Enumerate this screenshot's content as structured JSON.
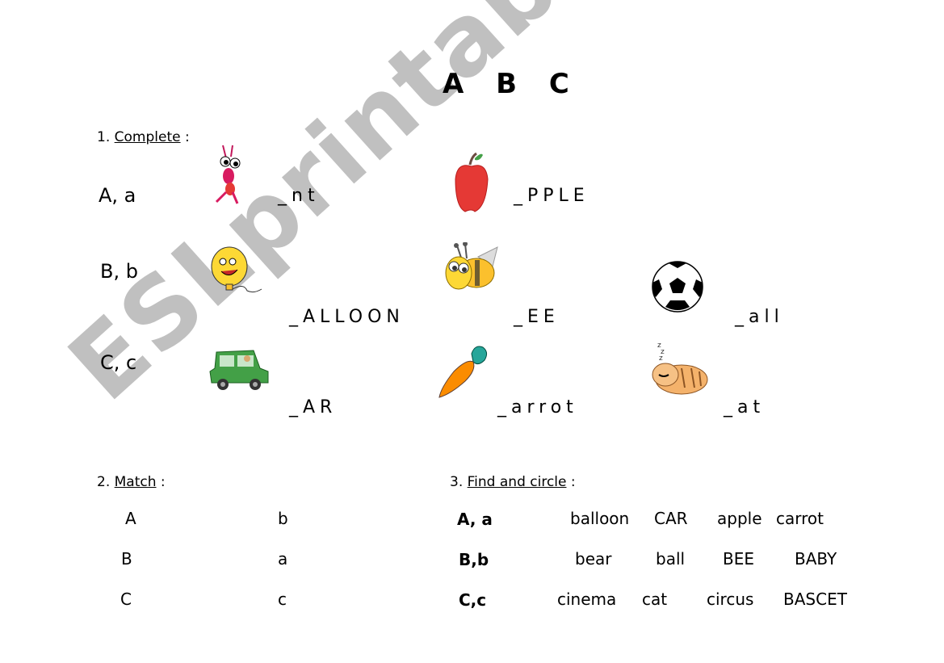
{
  "title": "A B C",
  "section1": {
    "number": "1.",
    "label": "Complete",
    "colon": ":",
    "rows": [
      {
        "letter": "A, a",
        "items": [
          {
            "picture": "ant-icon",
            "blank": "_nt"
          },
          {
            "picture": "apple-icon",
            "blank": "_PPLE"
          }
        ]
      },
      {
        "letter": "B, b",
        "items": [
          {
            "picture": "balloon-icon",
            "blank": "_ALLOON"
          },
          {
            "picture": "bee-icon",
            "blank": "_EE"
          },
          {
            "picture": "ball-icon",
            "blank": "_all"
          }
        ]
      },
      {
        "letter": "C, c",
        "items": [
          {
            "picture": "car-icon",
            "blank": "_AR"
          },
          {
            "picture": "carrot-icon",
            "blank": "_arrot"
          },
          {
            "picture": "cat-icon",
            "blank": "_at"
          }
        ]
      }
    ]
  },
  "section2": {
    "number": "2.",
    "label": "Match",
    "colon": ":",
    "left": [
      "A",
      "B",
      "C"
    ],
    "right": [
      "b",
      "a",
      "c"
    ]
  },
  "section3": {
    "number": "3.",
    "label": "Find and circle",
    "colon": ":",
    "rows": [
      {
        "letter": "A, a",
        "words": [
          "balloon",
          "CAR",
          "apple",
          "carrot"
        ]
      },
      {
        "letter": "B,b",
        "words": [
          "bear",
          "ball",
          "BEE",
          "BABY"
        ]
      },
      {
        "letter": "C,c",
        "words": [
          "cinema",
          "cat",
          "circus",
          "BASCET"
        ]
      }
    ]
  },
  "watermark": "ESLprintables.com"
}
